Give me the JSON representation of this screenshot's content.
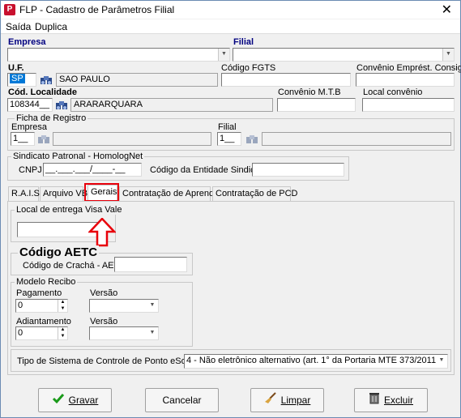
{
  "window": {
    "title": "FLP - Cadastro de Parâmetros Filial",
    "app_icon": "P",
    "close_glyph": "✕"
  },
  "menu": {
    "saida": "Saída",
    "duplica": "Duplica"
  },
  "header": {
    "empresa_label": "Empresa",
    "filial_label": "Filial",
    "uf_label": "U.F.",
    "uf_value": "SP",
    "uf_name": "SAO PAULO",
    "fgts_label": "Código FGTS",
    "convenio_emprest_label": "Convênio Emprést. Consig.",
    "cod_localidade_label": "Cód. Localidade",
    "cod_localidade_value": "108344__",
    "localidade_name": "ARARARQUARA",
    "convenio_mtb_label": "Convênio M.T.B",
    "local_convenio_label": "Local convênio"
  },
  "ficha": {
    "title": "Ficha de Registro",
    "empresa_label": "Empresa",
    "empresa_value": "1__",
    "filial_label": "Filial",
    "filial_value": "1__"
  },
  "sindicato": {
    "title": "Sindicato Patronal -  HomologNet",
    "cnpj_label": "CNPJ",
    "cnpj_mask": "__.___.___/____-__",
    "codigo_label": "Código da Entidade Sindical"
  },
  "tabs": [
    {
      "label": "R.A.I.S"
    },
    {
      "label": "Arquivo VB"
    },
    {
      "label": "Gerais"
    },
    {
      "label": "Contratação de Aprendiz"
    },
    {
      "label": "Contratação de PCD"
    }
  ],
  "gerais": {
    "visa_title": "Local de entrega Visa Vale",
    "aetc_title": "Código AETC",
    "cracha_label": "Código de Crachá - AETC",
    "modelo_title": "Modelo Recibo",
    "pagamento_label": "Pagamento",
    "pagamento_value": "0",
    "versao1_label": "Versão",
    "adiantamento_label": "Adiantamento",
    "adiantamento_value": "0",
    "versao2_label": "Versão",
    "ponto_label": "Tipo de Sistema de Controle de Ponto eSocial",
    "ponto_value": "4 - Não eletrônico alternativo (art. 1° da Portaria MTE 373/2011)"
  },
  "buttons": {
    "gravar": "Gravar",
    "cancelar": "Cancelar",
    "limpar": "Limpar",
    "excluir": "Excluir"
  },
  "colors": {
    "accent_red": "#e8000b",
    "selection_blue": "#0078d7",
    "label_blue": "#000080"
  }
}
